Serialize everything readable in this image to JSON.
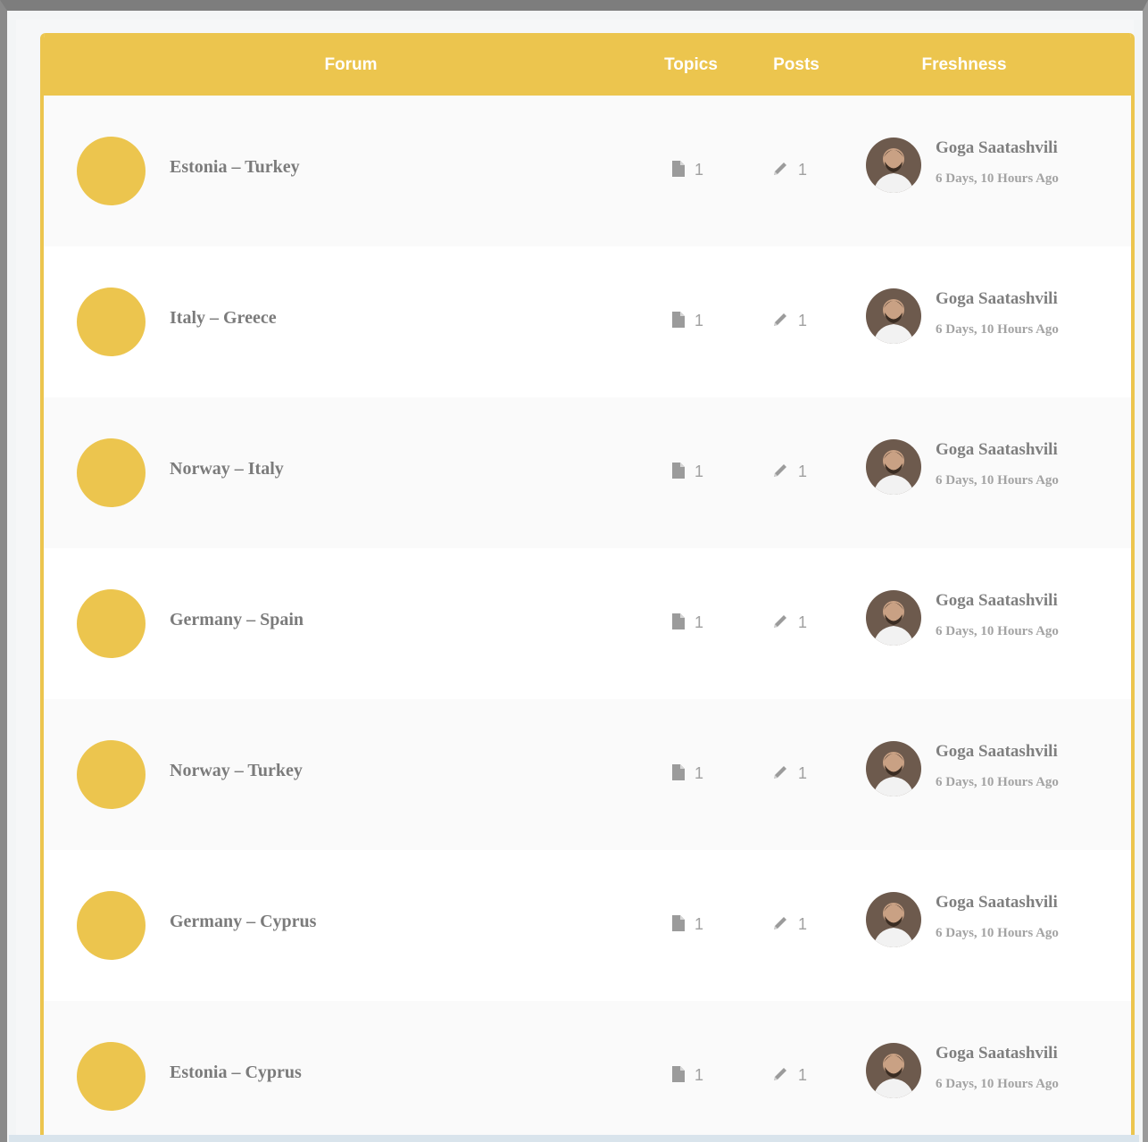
{
  "header": {
    "forum": "Forum",
    "topics": "Topics",
    "posts": "Posts",
    "freshness": "Freshness"
  },
  "colors": {
    "accent": "#ecc54e",
    "text": "#7b7b7b",
    "muted": "#a3a3a3"
  },
  "icons": {
    "topics": "document-icon",
    "posts": "pencil-icon"
  },
  "forums": [
    {
      "title": "Estonia – Turkey",
      "topics": "1",
      "posts": "1",
      "author": "Goga Saatashvili",
      "time": "6 Days, 10 Hours Ago"
    },
    {
      "title": "Italy – Greece",
      "topics": "1",
      "posts": "1",
      "author": "Goga Saatashvili",
      "time": "6 Days, 10 Hours Ago"
    },
    {
      "title": "Norway – Italy",
      "topics": "1",
      "posts": "1",
      "author": "Goga Saatashvili",
      "time": "6 Days, 10 Hours Ago"
    },
    {
      "title": "Germany – Spain",
      "topics": "1",
      "posts": "1",
      "author": "Goga Saatashvili",
      "time": "6 Days, 10 Hours Ago"
    },
    {
      "title": "Norway – Turkey",
      "topics": "1",
      "posts": "1",
      "author": "Goga Saatashvili",
      "time": "6 Days, 10 Hours Ago"
    },
    {
      "title": "Germany – Cyprus",
      "topics": "1",
      "posts": "1",
      "author": "Goga Saatashvili",
      "time": "6 Days, 10 Hours Ago"
    },
    {
      "title": "Estonia – Cyprus",
      "topics": "1",
      "posts": "1",
      "author": "Goga Saatashvili",
      "time": "6 Days, 10 Hours Ago"
    }
  ]
}
